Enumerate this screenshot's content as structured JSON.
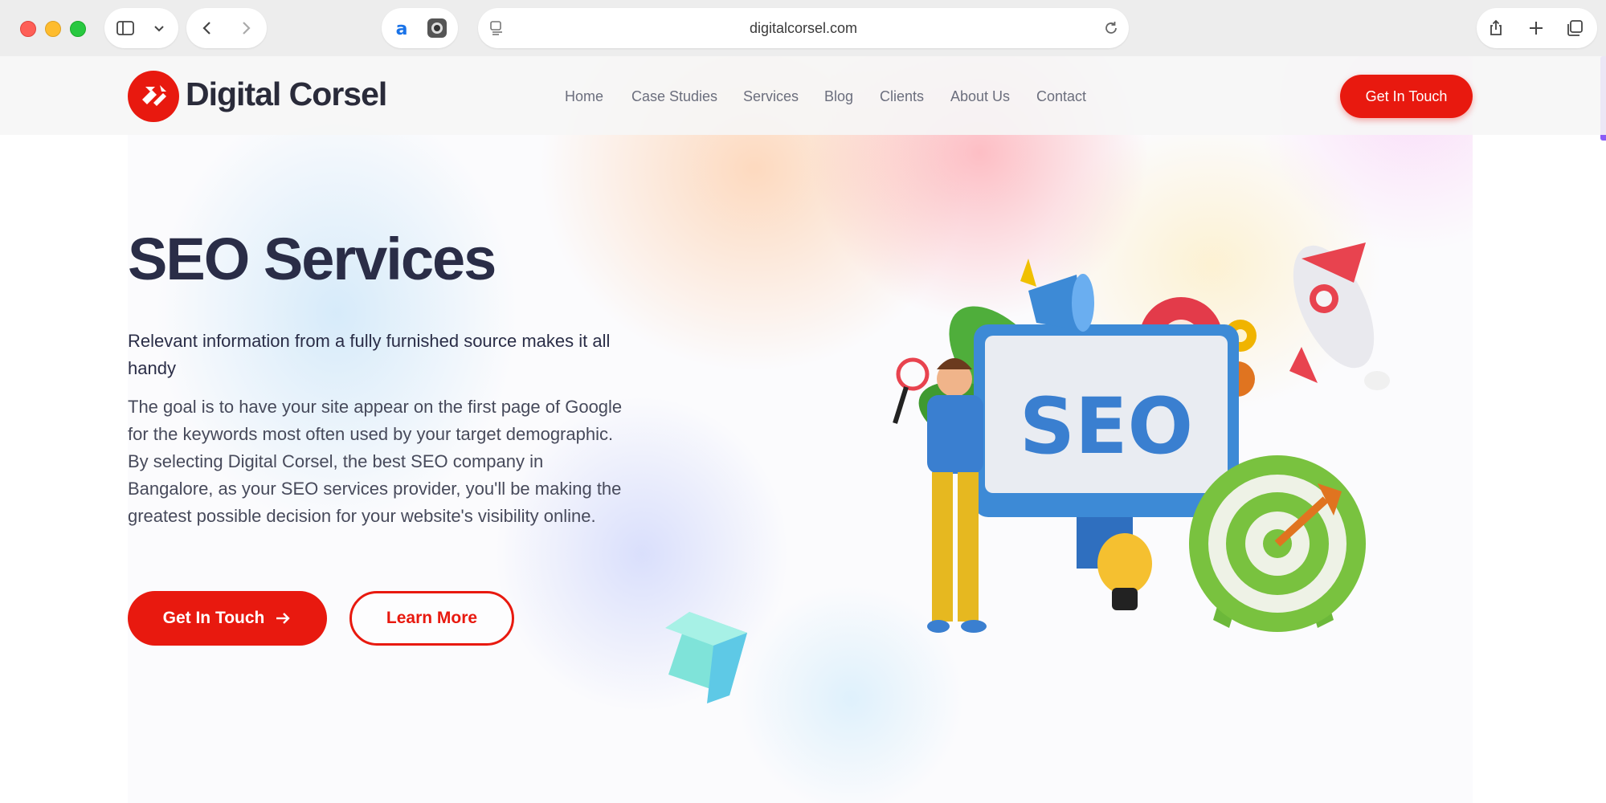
{
  "browser": {
    "url": "digitalcorsel.com"
  },
  "header": {
    "logo_text": "Digital Corsel",
    "nav": [
      "Home",
      "Case Studies",
      "Services",
      "Blog",
      "Clients",
      "About Us",
      "Contact"
    ],
    "cta_label": "Get In Touch"
  },
  "hero": {
    "title": "SEO Services",
    "subtitle": "Relevant information from a fully furnished source makes it all handy",
    "body": "The goal is to have your site appear on the first page of Google for the keywords most often used by your target demographic. By selecting Digital Corsel, the best SEO company in Bangalore, as your SEO services provider, you'll be making the greatest possible decision for your website's visibility online.",
    "primary_button": "Get In Touch",
    "secondary_button": "Learn More",
    "illustration_text": "SEO"
  },
  "colors": {
    "brand_red": "#e8190f",
    "heading_navy": "#2a2d47"
  }
}
